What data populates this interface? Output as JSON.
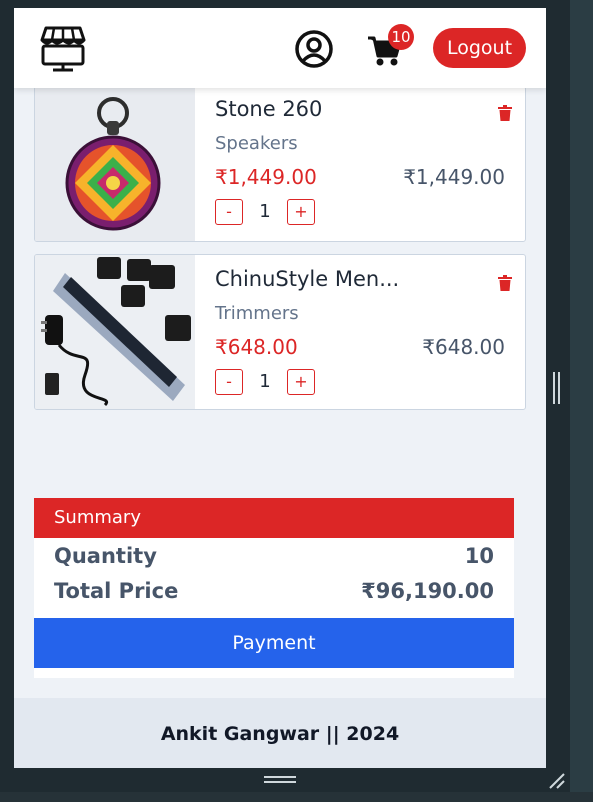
{
  "navbar": {
    "logo_icon": "storefront-monitor-icon",
    "user_icon": "user-circle-icon",
    "cart_icon": "shopping-cart-icon",
    "cart_count": "10",
    "logout_label": "Logout"
  },
  "cart": {
    "items": [
      {
        "name": "Stone 260",
        "category": "Speakers",
        "price": "₹1,449.00",
        "total": "₹1,449.00",
        "qty": "1",
        "minus": "-",
        "plus": "+",
        "image": "round-speaker-photo"
      },
      {
        "name": "ChinuStyle Men...",
        "category": "Trimmers",
        "price": "₹648.00",
        "total": "₹648.00",
        "qty": "1",
        "minus": "-",
        "plus": "+",
        "image": "trimmer-kit-photo"
      }
    ]
  },
  "summary": {
    "title": "Summary",
    "quantity_label": "Quantity",
    "quantity_value": "10",
    "total_label": "Total Price",
    "total_value": "₹96,190.00",
    "payment_label": "Payment"
  },
  "footer": {
    "text": "Ankit Gangwar || 2024"
  },
  "colors": {
    "accent_red": "#dc2626",
    "payment_blue": "#2563eb",
    "page_bg": "#eef2f7"
  }
}
